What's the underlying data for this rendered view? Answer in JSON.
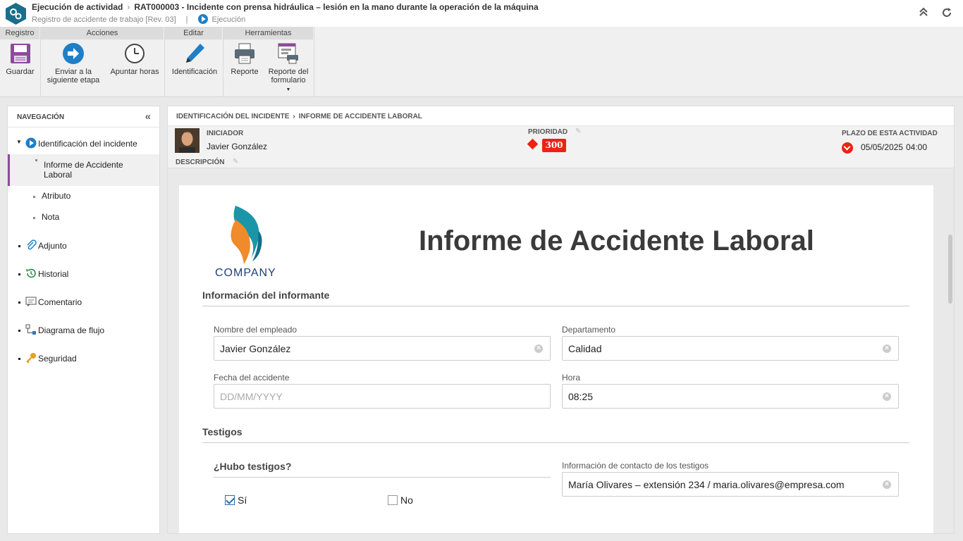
{
  "header": {
    "module": "Ejecución de actividad",
    "record_title": "RAT000003 - Incidente con prensa hidráulica – lesión en la mano durante la operación de la máquina",
    "subtitle": "Registro de accidente de trabajo [Rev. 03]",
    "separator": "|",
    "stage": "Ejecución",
    "icons": {
      "collapse": "double-chevron-up-icon",
      "refresh": "refresh-icon"
    }
  },
  "ribbon": {
    "groups": [
      {
        "label": "Registro",
        "buttons": [
          {
            "label": "Guardar",
            "icon": "save-icon"
          }
        ]
      },
      {
        "label": "Acciones",
        "buttons": [
          {
            "label": "Enviar a la siguiente etapa",
            "icon": "arrow-right-icon"
          },
          {
            "label": "Apuntar horas",
            "icon": "clock-icon"
          }
        ]
      },
      {
        "label": "Editar",
        "buttons": [
          {
            "label": "Identificación",
            "icon": "pencil-icon"
          }
        ]
      },
      {
        "label": "Herramientas",
        "buttons": [
          {
            "label": "Reporte",
            "icon": "printer-icon"
          },
          {
            "label": "Reporte del formulario",
            "icon": "form-report-icon"
          }
        ]
      }
    ]
  },
  "nav": {
    "title": "NAVEGACIÓN",
    "items": [
      {
        "label": "Identificación del incidente",
        "icon": "play-circle-icon",
        "expanded": true
      },
      {
        "label": "Informe de Accidente Laboral",
        "selected": true
      },
      {
        "label": "Atributo"
      },
      {
        "label": "Nota"
      },
      {
        "label": "Adjunto",
        "icon": "paperclip-icon"
      },
      {
        "label": "Historial",
        "icon": "history-icon"
      },
      {
        "label": "Comentario",
        "icon": "comment-icon"
      },
      {
        "label": "Diagrama de flujo",
        "icon": "flowchart-icon"
      },
      {
        "label": "Seguridad",
        "icon": "key-icon"
      }
    ]
  },
  "main": {
    "breadcrumb": [
      "IDENTIFICACIÓN DEL INCIDENTE",
      "INFORME DE ACCIDENTE LABORAL"
    ],
    "initiator_label": "INICIADOR",
    "initiator": "Javier González",
    "priority_label": "PRIORIDAD",
    "priority": "300",
    "deadline_label": "PLAZO DE ESTA ACTIVIDAD",
    "deadline_date": "05/05/2025",
    "deadline_time": "04:00",
    "description_label": "DESCRIPCIÓN",
    "colors": {
      "accent": "#1e7fc8",
      "priority": "#ee2211"
    }
  },
  "form": {
    "logo_text": "COMPANY",
    "title": "Informe de Accidente Laboral",
    "section_reporter": "Información del informante",
    "employee_label": "Nombre del empleado",
    "employee_value": "Javier González",
    "department_label": "Departamento",
    "department_value": "Calidad",
    "date_label": "Fecha del accidente",
    "date_placeholder": "DD/MM/YYYY",
    "time_label": "Hora",
    "time_value": "08:25",
    "section_witnesses": "Testigos",
    "witness_question": "¿Hubo testigos?",
    "witness_yes": "Sí",
    "witness_no": "No",
    "witness_yes_checked": true,
    "witness_no_checked": false,
    "witness_contact_label": "Información de contacto de los testigos",
    "witness_contact_value": "María Olivares – extensión 234 / maria.olivares@empresa.com"
  }
}
